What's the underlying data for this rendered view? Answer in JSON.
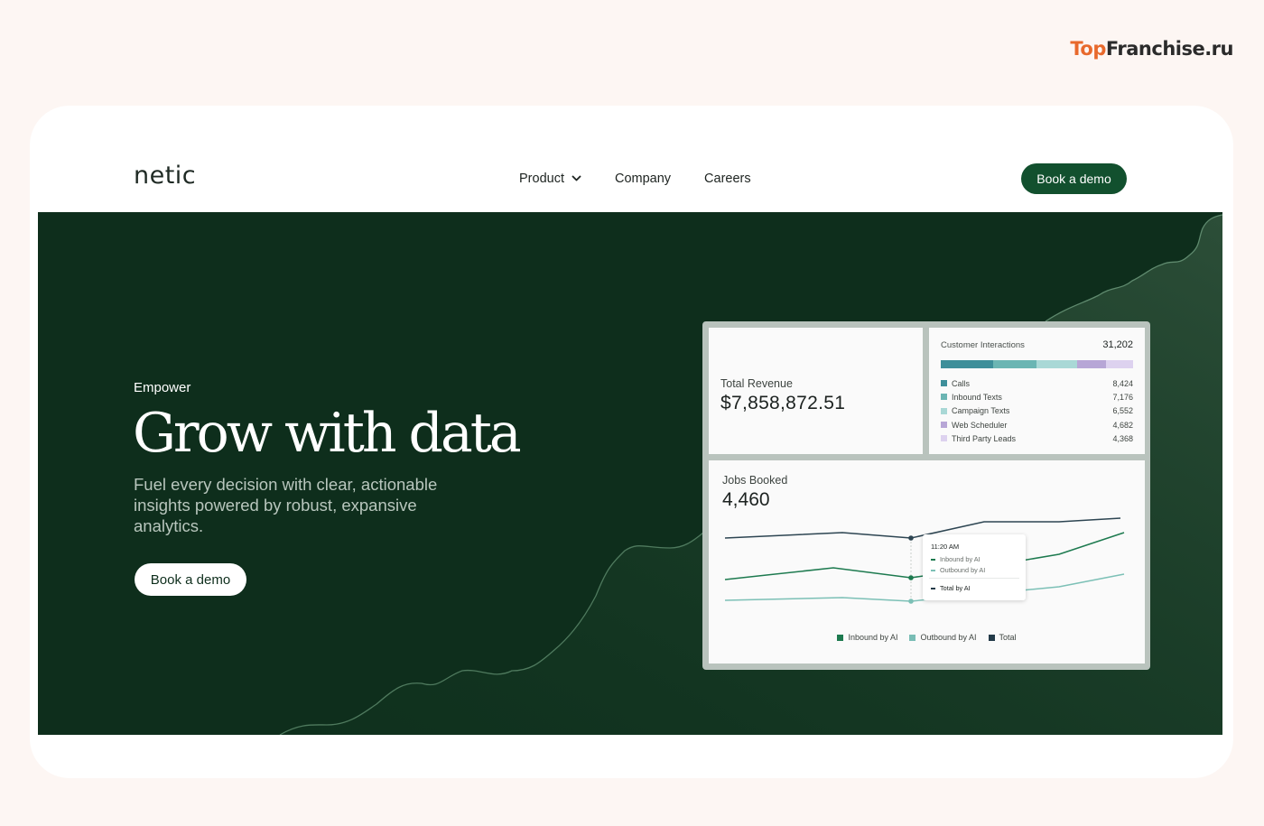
{
  "watermark": {
    "part1": "Top",
    "part2": "Franchise.ru"
  },
  "nav": {
    "logo": "netic",
    "links": [
      "Product",
      "Company",
      "Careers"
    ],
    "cta": "Book a demo"
  },
  "hero": {
    "eyebrow": "Empower",
    "headline": "Grow with data",
    "subhead": "Fuel every decision with clear, actionable insights powered by robust, expansive analytics.",
    "cta": "Book a demo"
  },
  "dashboard": {
    "revenue": {
      "label": "Total Revenue",
      "value": "$7,858,872.51"
    },
    "interactions": {
      "title": "Customer Interactions",
      "total": "31,202",
      "items": [
        {
          "name": "Calls",
          "value": "8,424",
          "count": 8424,
          "color": "#3e8f9a"
        },
        {
          "name": "Inbound Texts",
          "value": "7,176",
          "count": 7176,
          "color": "#6bb5b3"
        },
        {
          "name": "Campaign Texts",
          "value": "6,552",
          "count": 6552,
          "color": "#a9d8d6"
        },
        {
          "name": "Web Scheduler",
          "value": "4,682",
          "count": 4682,
          "color": "#b7a6d6"
        },
        {
          "name": "Third Party Leads",
          "value": "4,368",
          "count": 4368,
          "color": "#ddd2ef"
        }
      ]
    },
    "jobs": {
      "label": "Jobs Booked",
      "value": "4,460",
      "tooltip": {
        "time": "11:20 AM",
        "rows": [
          "Inbound by AI",
          "Outbound by AI",
          "Total by AI"
        ]
      },
      "legend": [
        {
          "name": "Inbound by AI",
          "color": "#1d7a4f"
        },
        {
          "name": "Outbound by AI",
          "color": "#79bdb5"
        },
        {
          "name": "Total",
          "color": "#223a48"
        }
      ],
      "colors": {
        "total": "#2d4552",
        "inbound": "#1d7a4f",
        "outbound": "#7cc0b6"
      }
    }
  },
  "colors": {
    "brand_green": "#12502e",
    "hero_bg": "#0e2e1c",
    "page_bg": "#fdf6f3"
  }
}
